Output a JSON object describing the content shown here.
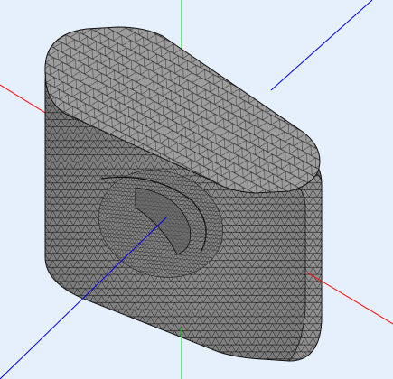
{
  "viewport": {
    "background": "#e5f0fc",
    "axes": {
      "x": "#ff0000",
      "y": "#00e000",
      "z": "#0000ee"
    },
    "mesh": {
      "element_type": "triangle",
      "face_color": "#8e8e8e",
      "top_face_color": "#9d9d9d",
      "edge_color": "#000000",
      "outline_color": "#111111"
    }
  }
}
